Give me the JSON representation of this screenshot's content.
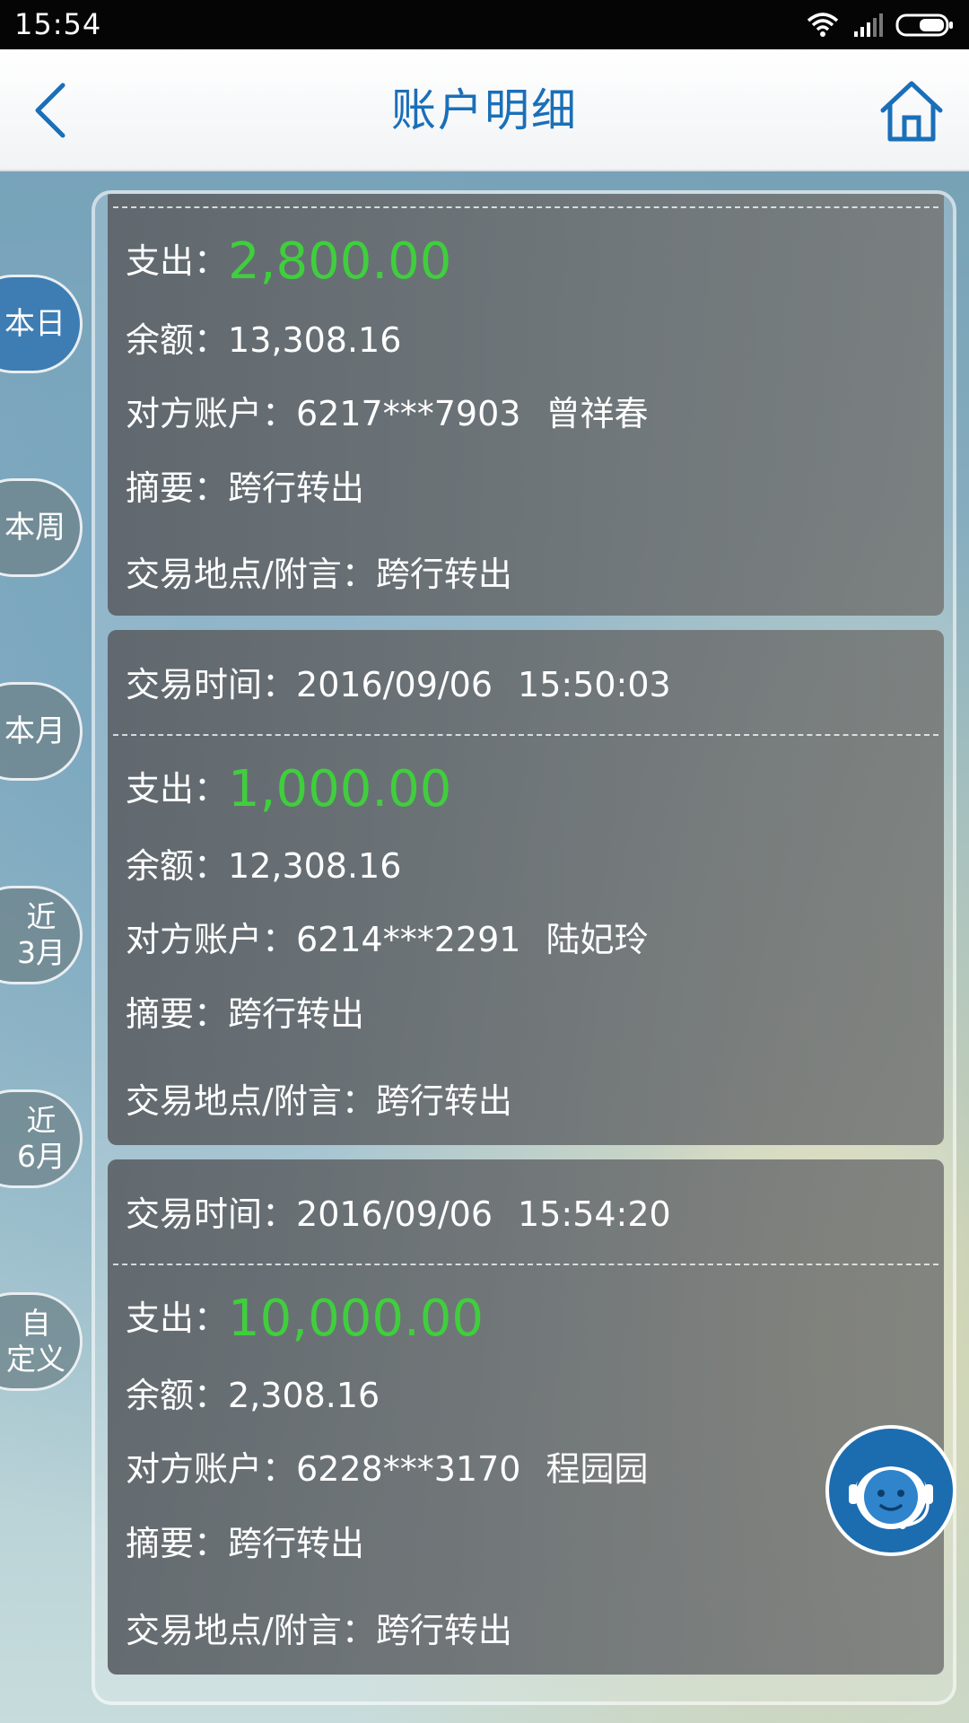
{
  "status_bar": {
    "time": "15:54"
  },
  "header": {
    "title": "账户明细",
    "back_icon": "chevron-left-icon",
    "home_icon": "home-icon"
  },
  "filters": [
    {
      "label": "本日",
      "active": true
    },
    {
      "label": "本周",
      "active": false
    },
    {
      "label": "本月",
      "active": false
    },
    {
      "label": "近\n3月",
      "active": false
    },
    {
      "label": "近\n6月",
      "active": false
    },
    {
      "label": "自\n定义",
      "active": false
    }
  ],
  "labels": {
    "time": "交易时间：",
    "expense": "支出：",
    "balance": "余额：",
    "counterparty": "对方账户：",
    "summary": "摘要：",
    "location": "交易地点/附言："
  },
  "transactions": [
    {
      "date": "",
      "time": "",
      "amount": "2,800.00",
      "balance": "13,308.16",
      "account": "6217***7903",
      "name": "曾祥春",
      "summary": "跨行转出",
      "location": "跨行转出"
    },
    {
      "date": "2016/09/06",
      "time": "15:50:03",
      "amount": "1,000.00",
      "balance": "12,308.16",
      "account": "6214***2291",
      "name": "陆妃玲",
      "summary": "跨行转出",
      "location": "跨行转出"
    },
    {
      "date": "2016/09/06",
      "time": "15:54:20",
      "amount": "10,000.00",
      "balance": "2,308.16",
      "account": "6228***3170",
      "name": "程园园",
      "summary": "跨行转出",
      "location": "跨行转出"
    }
  ],
  "colors": {
    "accent": "#1a6fb8",
    "amount": "#3fcf3c",
    "active_tab": "#3d7db3"
  },
  "customer_service_icon": "customer-service-agent-icon"
}
